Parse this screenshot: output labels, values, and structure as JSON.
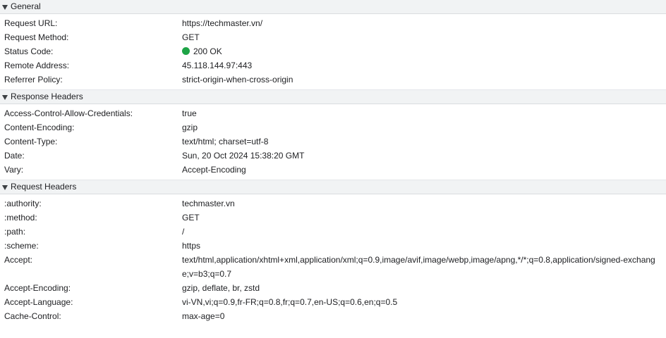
{
  "general": {
    "title": "General",
    "rows": [
      {
        "key": "Request URL:",
        "value": "https://techmaster.vn/"
      },
      {
        "key": "Request Method:",
        "value": "GET"
      },
      {
        "key": "Status Code:",
        "value": "200 OK"
      },
      {
        "key": "Remote Address:",
        "value": "45.118.144.97:443"
      },
      {
        "key": "Referrer Policy:",
        "value": "strict-origin-when-cross-origin"
      }
    ],
    "status_color": "#1ea446"
  },
  "response_headers": {
    "title": "Response Headers",
    "rows": [
      {
        "key": "Access-Control-Allow-Credentials:",
        "value": "true"
      },
      {
        "key": "Content-Encoding:",
        "value": "gzip"
      },
      {
        "key": "Content-Type:",
        "value": "text/html; charset=utf-8"
      },
      {
        "key": "Date:",
        "value": "Sun, 20 Oct 2024 15:38:20 GMT"
      },
      {
        "key": "Vary:",
        "value": "Accept-Encoding"
      }
    ]
  },
  "request_headers": {
    "title": "Request Headers",
    "rows": [
      {
        "key": ":authority:",
        "value": "techmaster.vn"
      },
      {
        "key": ":method:",
        "value": "GET"
      },
      {
        "key": ":path:",
        "value": "/"
      },
      {
        "key": ":scheme:",
        "value": "https"
      },
      {
        "key": "Accept:",
        "value": "text/html,application/xhtml+xml,application/xml;q=0.9,image/avif,image/webp,image/apng,*/*;q=0.8,application/signed-exchange;v=b3;q=0.7"
      },
      {
        "key": "Accept-Encoding:",
        "value": "gzip, deflate, br, zstd"
      },
      {
        "key": "Accept-Language:",
        "value": "vi-VN,vi;q=0.9,fr-FR;q=0.8,fr;q=0.7,en-US;q=0.6,en;q=0.5"
      },
      {
        "key": "Cache-Control:",
        "value": "max-age=0"
      }
    ]
  }
}
